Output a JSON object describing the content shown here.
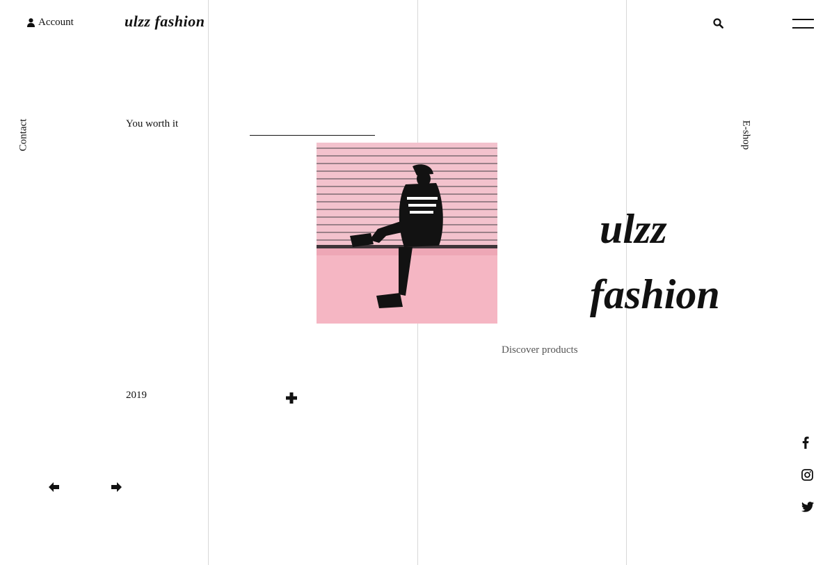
{
  "header": {
    "account_label": "Account",
    "logo": "ulzz fashion",
    "icons": {
      "account": "user-icon",
      "search": "search-icon",
      "menu": "hamburger-menu-icon"
    }
  },
  "side_nav": {
    "left": "Contact",
    "right": "E-shop"
  },
  "hero": {
    "tagline": "You worth it",
    "brand_line1": "ulzz",
    "brand_line2": "fashion",
    "cta": "Discover products",
    "year": "2019",
    "photo_icon": "fashion-photo"
  },
  "slider": {
    "prev_icon": "arrow-left-icon",
    "next_icon": "arrow-right-icon",
    "add_icon": "plus-icon"
  },
  "social": [
    "facebook-icon",
    "instagram-icon",
    "twitter-icon"
  ],
  "colors": {
    "accent_pink": "#f4c3cf",
    "text": "#111111",
    "muted": "#555555",
    "grid_line": "#d8d8d8"
  }
}
